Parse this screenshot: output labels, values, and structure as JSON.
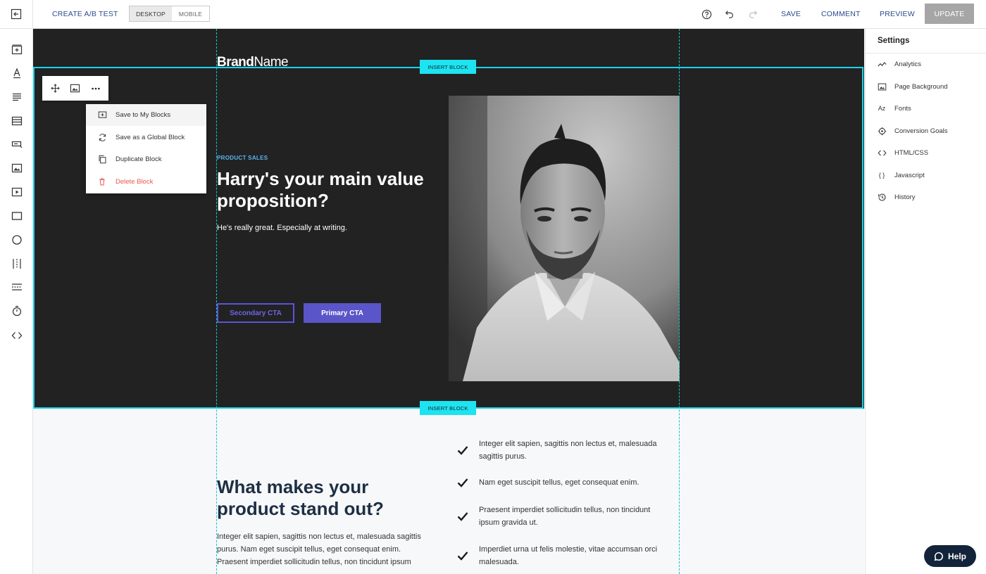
{
  "topbar": {
    "ab_test_label": "CREATE A/B TEST",
    "device_desktop": "DESKTOP",
    "device_mobile": "MOBILE",
    "save_label": "SAVE",
    "comment_label": "COMMENT",
    "preview_label": "PREVIEW",
    "update_label": "UPDATE"
  },
  "left_tools": [
    "add-block-icon",
    "text-icon",
    "paragraph-icon",
    "list-icon",
    "form-icon",
    "image-icon",
    "video-icon",
    "box-icon",
    "circle-icon",
    "columns-icon",
    "divider-icon",
    "timer-icon",
    "code-icon"
  ],
  "settings": {
    "title": "Settings",
    "items": [
      {
        "label": "Analytics",
        "icon": "analytics-icon"
      },
      {
        "label": "Page Background",
        "icon": "image-icon"
      },
      {
        "label": "Fonts",
        "icon": "fonts-icon",
        "glyph": "Az"
      },
      {
        "label": "Conversion Goals",
        "icon": "target-icon"
      },
      {
        "label": "HTML/CSS",
        "icon": "code-icon"
      },
      {
        "label": "Javascript",
        "icon": "braces-icon",
        "glyph": "{ }"
      },
      {
        "label": "History",
        "icon": "history-icon"
      }
    ]
  },
  "canvas": {
    "insert_block_label": "INSERT BLOCK",
    "brand_bold": "Brand",
    "brand_regular": "Name",
    "hero": {
      "eyebrow": "PRODUCT SALES",
      "headline": "Harry's your main value proposition?",
      "subline": "He's really great. Especially at writing.",
      "secondary_cta": "Secondary CTA",
      "primary_cta": "Primary CTA"
    },
    "block_menu": [
      {
        "label": "Save to My Blocks",
        "icon": "save-block-icon"
      },
      {
        "label": "Save as a Global Block",
        "icon": "sync-icon"
      },
      {
        "label": "Duplicate Block",
        "icon": "duplicate-icon"
      },
      {
        "label": "Delete Block",
        "icon": "trash-icon"
      }
    ],
    "section2": {
      "title": "What makes your product stand out?",
      "body": "Integer elit sapien, sagittis non lectus et, malesuada sagittis purus. Nam eget suscipit tellus, eget consequat enim. Praesent imperdiet sollicitudin tellus, non tincidunt ipsum",
      "features": [
        "Integer elit sapien, sagittis non lectus et, malesuada sagittis purus.",
        "Nam eget suscipit tellus, eget consequat enim.",
        "Praesent imperdiet sollicitudin tellus, non tincidunt ipsum gravida ut.",
        "Imperdiet urna ut felis molestie, vitae accumsan orci malesuada."
      ]
    }
  },
  "help_label": "Help",
  "colors": {
    "accent_cyan": "#17d3ea",
    "hero_bg": "#222222",
    "cta": "#5a55c8",
    "link_blue": "#2d4a8a",
    "danger": "#e8574f"
  }
}
